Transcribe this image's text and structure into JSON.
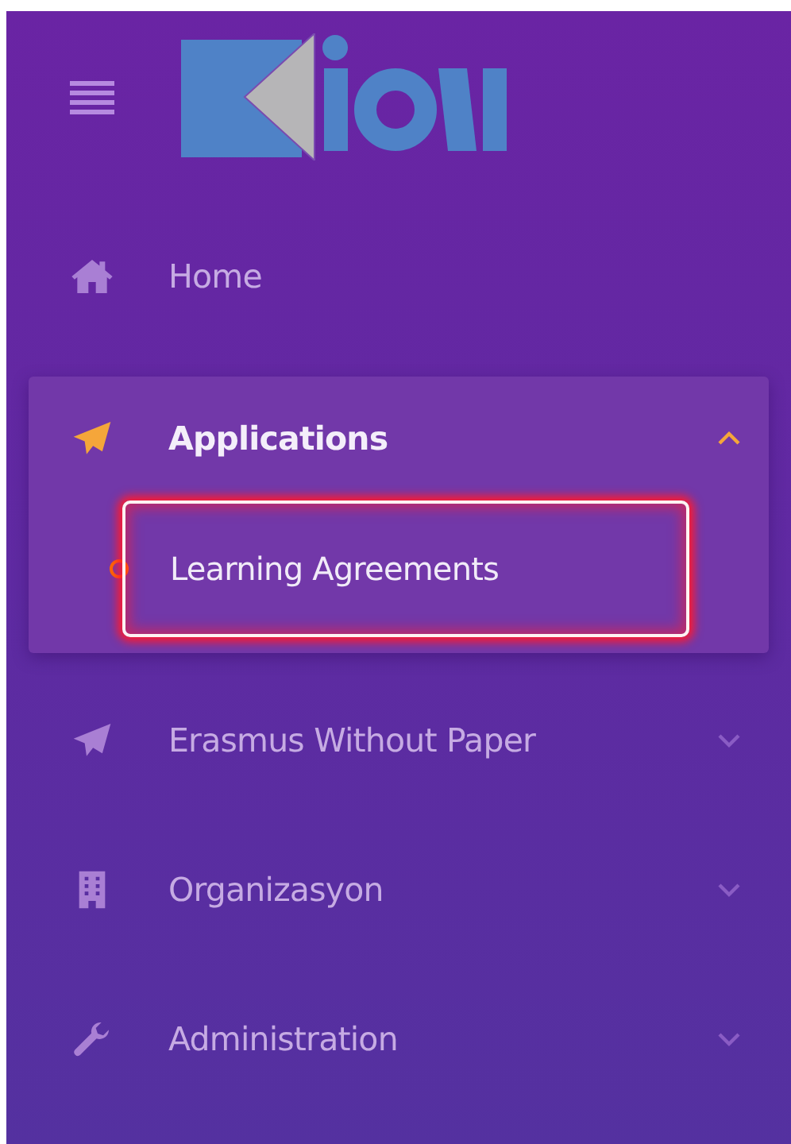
{
  "menu": [
    {
      "label": "Home",
      "selected": false
    },
    {
      "label": "Applications",
      "selected": true,
      "expanded": true,
      "children": [
        {
          "label": "Learning Agreements",
          "selected": true
        }
      ]
    },
    {
      "label": "Erasmus Without Paper",
      "selected": false,
      "expanded": false
    },
    {
      "label": "Organizasyon",
      "selected": false,
      "expanded": false
    },
    {
      "label": "Administration",
      "selected": false,
      "expanded": false
    }
  ]
}
